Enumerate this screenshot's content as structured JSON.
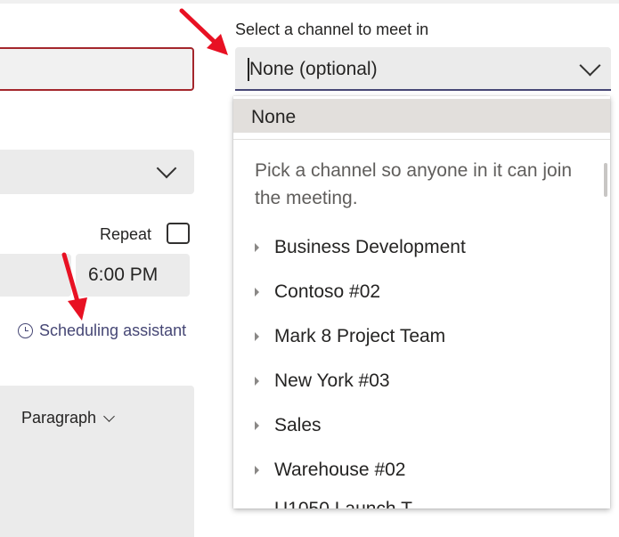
{
  "form": {
    "repeat_label": "Repeat",
    "end_time": "6:00 PM",
    "scheduling_assistant": "Scheduling assistant",
    "paragraph_label": "Paragraph"
  },
  "channel": {
    "label": "Select a channel to meet in",
    "selected_value": "None (optional)",
    "dropdown": {
      "none_option": "None",
      "hint": "Pick a channel so anyone in it can join the meeting.",
      "teams": [
        "Business Development",
        "Contoso #02",
        "Mark 8 Project Team",
        "New York #03",
        "Sales",
        "Warehouse #02"
      ],
      "partial_item": "U1050 Launch T..."
    }
  },
  "colors": {
    "accent": "#464775",
    "error_border": "#a4262c",
    "annotation_arrow": "#e81123"
  },
  "icons": {
    "chevron": "chevron-down-icon",
    "clock": "clock-icon",
    "expand": "caret-right-icon",
    "checkbox": "checkbox-icon"
  }
}
